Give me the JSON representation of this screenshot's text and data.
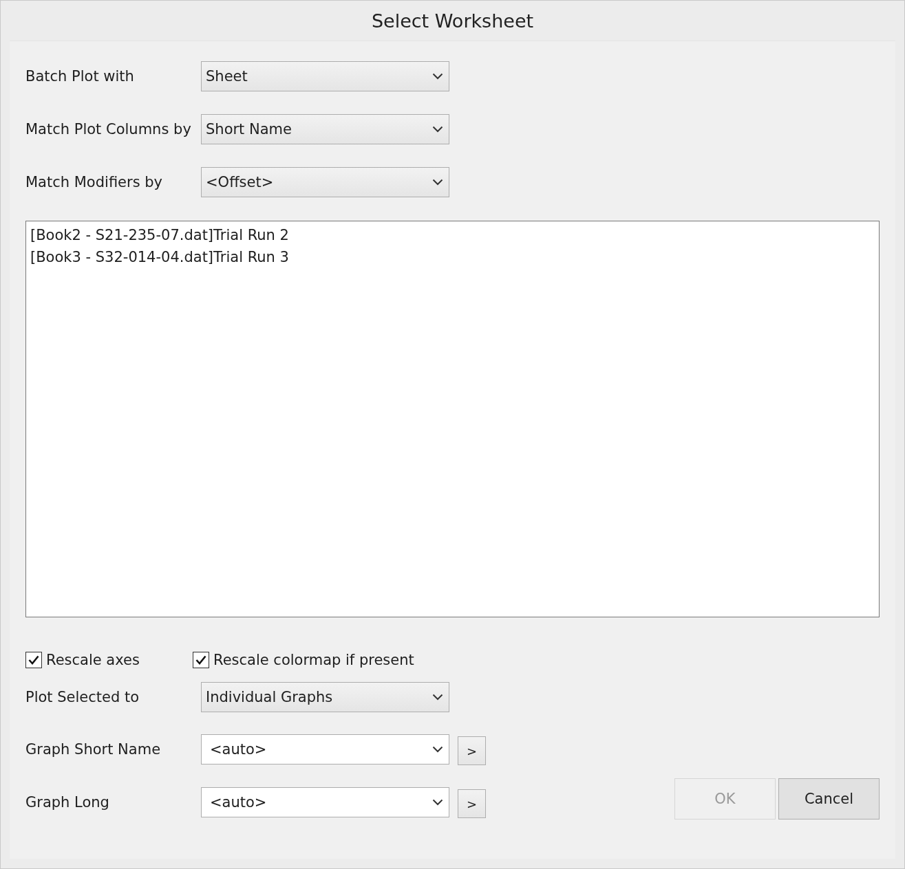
{
  "window": {
    "title": "Select Worksheet"
  },
  "options": [
    {
      "label": "Batch Plot with",
      "kind": "select",
      "value": "Sheet"
    },
    {
      "label": "Match Plot Columns by",
      "kind": "select",
      "value": "Short Name"
    },
    {
      "label": "Match Modifiers by",
      "kind": "select",
      "value": "<Offset>"
    }
  ],
  "list": {
    "items": [
      "[Book2 - S21-235-07.dat]Trial Run 2",
      "[Book3 - S32-014-04.dat]Trial Run 3"
    ]
  },
  "checkboxes": [
    {
      "label": "Rescale axes",
      "checked": true
    },
    {
      "label": "Rescale colormap if present",
      "checked": true
    }
  ],
  "outputs": [
    {
      "label": "Plot Selected to",
      "kind": "select",
      "value": "Individual Graphs"
    },
    {
      "label": "Graph Short Name",
      "kind": "combo",
      "value": "<auto>",
      "button": ">"
    },
    {
      "label": "Graph Long",
      "kind": "combo",
      "value": "<auto>",
      "button": ">"
    }
  ],
  "buttons": [
    {
      "label": "OK",
      "disabled": true
    },
    {
      "label": "Cancel",
      "disabled": false
    }
  ]
}
